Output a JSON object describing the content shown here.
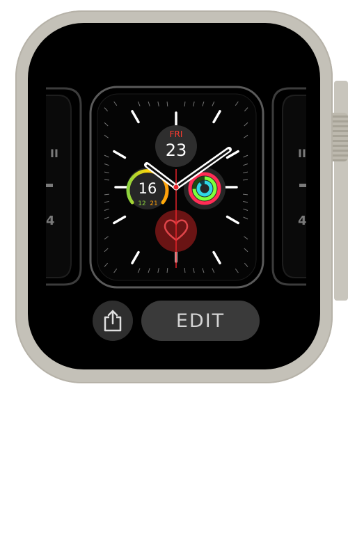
{
  "watch_face": {
    "day": "FRI",
    "date": "23",
    "temperature": "16",
    "temp_low": "12",
    "temp_high": "21",
    "side_face_marks": [
      "II",
      "4"
    ]
  },
  "actions": {
    "edit_label": "EDIT"
  },
  "colors": {
    "case": "#c4c1b8",
    "screen": "#000000",
    "day_red": "#ff3b30",
    "heart_red": "#8b1a1a",
    "second_hand": "#e8232a",
    "ring_move": "#ff2d55",
    "ring_exercise": "#7dff3c",
    "ring_stand": "#2fd8e6"
  },
  "icons": [
    "share-icon",
    "heart-icon",
    "activity-rings-icon",
    "temperature-gauge-icon"
  ]
}
